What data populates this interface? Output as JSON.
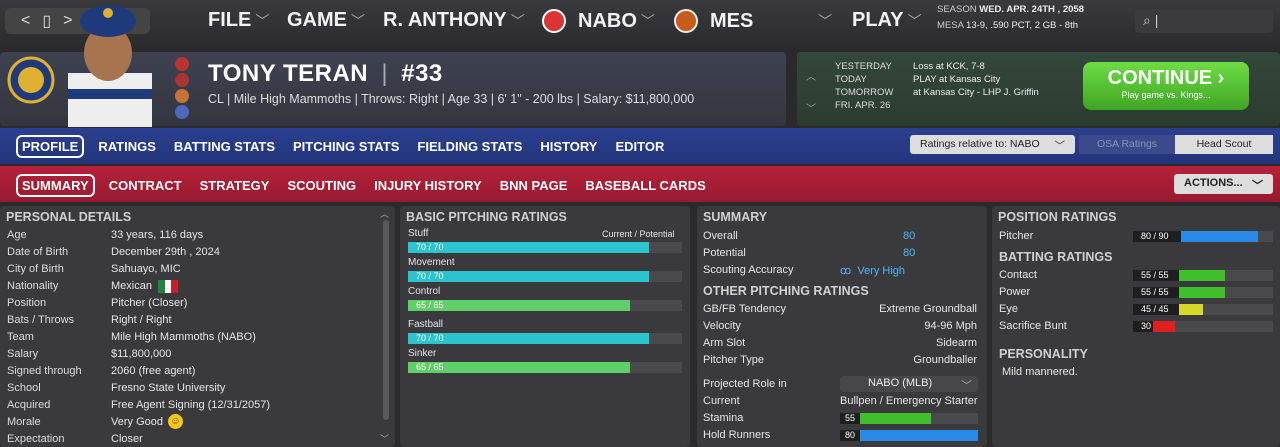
{
  "topbar": {
    "menus": [
      "FILE",
      "GAME",
      "R. ANTHONY",
      "NABO",
      "MES",
      "PLAY"
    ],
    "season_label": "SEASON",
    "season_date": "WED. APR. 24TH , 2058",
    "team_label": "MESA",
    "team_record": "13-9, .590 PCT, 2 GB - 8th",
    "search_placeholder": "|"
  },
  "player": {
    "name": "TONY TERAN",
    "number": "#33",
    "info": "CL | Mile High Mammoths  |  Throws: Right  |  Age 33  |  6' 1\" - 200 lbs  |  Salary: $11,800,000"
  },
  "schedule": {
    "labels": [
      "YESTERDAY",
      "TODAY",
      "TOMORROW",
      "FRI. APR. 26"
    ],
    "values": [
      "Loss at KCK, 7-8",
      "PLAY at Kansas City",
      "at Kansas City - LHP J. Griffin",
      ""
    ],
    "continue_label": "CONTINUE",
    "continue_sub": "Play game vs. Kings..."
  },
  "tabs": {
    "main": [
      "PROFILE",
      "RATINGS",
      "BATTING STATS",
      "PITCHING STATS",
      "FIELDING STATS",
      "HISTORY",
      "EDITOR"
    ],
    "sub": [
      "SUMMARY",
      "CONTRACT",
      "STRATEGY",
      "SCOUTING",
      "INJURY HISTORY",
      "BNN PAGE",
      "BASEBALL CARDS"
    ],
    "ratings_relative": "Ratings relative to: NABO",
    "osa": "OSA Ratings",
    "head_scout": "Head Scout",
    "actions": "ACTIONS..."
  },
  "personal": {
    "title": "PERSONAL DETAILS",
    "rows": [
      {
        "k": "Age",
        "v": "33 years, 116 days"
      },
      {
        "k": "Date of Birth",
        "v": "December 29th , 2024"
      },
      {
        "k": "City of Birth",
        "v": "Sahuayo, MIC"
      },
      {
        "k": "Nationality",
        "v": "Mexican"
      },
      {
        "k": "Position",
        "v": "Pitcher (Closer)"
      },
      {
        "k": "Bats / Throws",
        "v": "Right / Right"
      },
      {
        "k": "Team",
        "v": "Mile High Mammoths (NABO)"
      },
      {
        "k": "Salary",
        "v": "$11,800,000"
      },
      {
        "k": "Signed through",
        "v": "2060 (free agent)"
      },
      {
        "k": "School",
        "v": "Fresno State University"
      },
      {
        "k": "Acquired",
        "v": "Free Agent Signing (12/31/2057)"
      },
      {
        "k": "Morale",
        "v": "Very Good"
      },
      {
        "k": "Expectation",
        "v": "Closer"
      }
    ]
  },
  "pitching": {
    "title": "BASIC PITCHING RATINGS",
    "cp": "Current / Potential",
    "bars": [
      {
        "name": "Stuff",
        "text": "70 / 70",
        "pct": 0.88,
        "color": "#2bc4cf"
      },
      {
        "name": "Movement",
        "text": "70 / 70",
        "pct": 0.88,
        "color": "#2bc4cf"
      },
      {
        "name": "Control",
        "text": "65 / 65",
        "pct": 0.81,
        "color": "#5fcf6a"
      },
      {
        "name": "Fastball",
        "text": "70 / 70",
        "pct": 0.88,
        "color": "#2bc4cf"
      },
      {
        "name": "Sinker",
        "text": "65 / 65",
        "pct": 0.81,
        "color": "#5fcf6a"
      }
    ]
  },
  "summary": {
    "title": "SUMMARY",
    "overall_label": "Overall",
    "overall": "80",
    "potential_label": "Potential",
    "potential": "80",
    "scouting_label": "Scouting Accuracy",
    "scouting": "Very High",
    "other_title": "OTHER PITCHING RATINGS",
    "rows": [
      {
        "k": "GB/FB Tendency",
        "v": "Extreme Groundball"
      },
      {
        "k": "Velocity",
        "v": "94-96 Mph"
      },
      {
        "k": "Arm Slot",
        "v": "Sidearm"
      },
      {
        "k": "Pitcher Type",
        "v": "Groundballer"
      }
    ],
    "role_label": "Projected Role in",
    "role_select": "NABO (MLB)",
    "current_label": "Current",
    "current": "Bullpen / Emergency Starter",
    "stamina_label": "Stamina",
    "stamina": "55",
    "stamina_pct": 0.66,
    "holdrunners_label": "Hold Runners",
    "holdrunners": "80",
    "holdrunners_pct": 1.0
  },
  "position": {
    "title": "POSITION RATINGS",
    "pitcher_label": "Pitcher",
    "pitcher": "80 / 90",
    "pitcher_pct": 0.89,
    "batting_title": "BATTING RATINGS",
    "bars": [
      {
        "name": "Contact",
        "text": "55 / 55",
        "pct": 0.66,
        "color": "#3fbf2a"
      },
      {
        "name": "Power",
        "text": "55 / 55",
        "pct": 0.66,
        "color": "#3fbf2a"
      },
      {
        "name": "Eye",
        "text": "45 / 45",
        "pct": 0.5,
        "color": "#d8d82a"
      },
      {
        "name": "Sacrifice Bunt",
        "text": "30",
        "pct": 0.3,
        "color": "#e02020"
      }
    ],
    "personality_title": "PERSONALITY",
    "personality": "Mild mannered."
  }
}
